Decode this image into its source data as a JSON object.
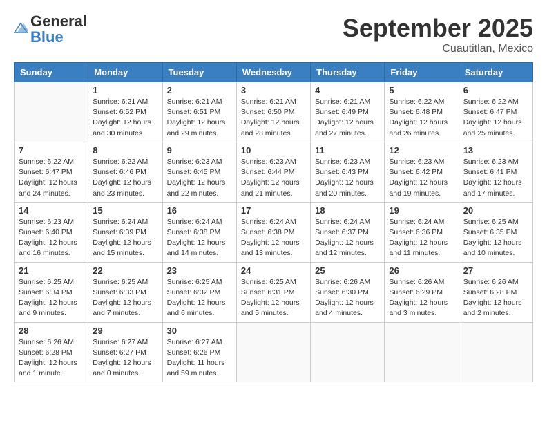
{
  "header": {
    "logo_general": "General",
    "logo_blue": "Blue",
    "title": "September 2025",
    "location": "Cuautitlan, Mexico"
  },
  "weekdays": [
    "Sunday",
    "Monday",
    "Tuesday",
    "Wednesday",
    "Thursday",
    "Friday",
    "Saturday"
  ],
  "weeks": [
    [
      {
        "day": "",
        "info": ""
      },
      {
        "day": "1",
        "info": "Sunrise: 6:21 AM\nSunset: 6:52 PM\nDaylight: 12 hours\nand 30 minutes."
      },
      {
        "day": "2",
        "info": "Sunrise: 6:21 AM\nSunset: 6:51 PM\nDaylight: 12 hours\nand 29 minutes."
      },
      {
        "day": "3",
        "info": "Sunrise: 6:21 AM\nSunset: 6:50 PM\nDaylight: 12 hours\nand 28 minutes."
      },
      {
        "day": "4",
        "info": "Sunrise: 6:21 AM\nSunset: 6:49 PM\nDaylight: 12 hours\nand 27 minutes."
      },
      {
        "day": "5",
        "info": "Sunrise: 6:22 AM\nSunset: 6:48 PM\nDaylight: 12 hours\nand 26 minutes."
      },
      {
        "day": "6",
        "info": "Sunrise: 6:22 AM\nSunset: 6:47 PM\nDaylight: 12 hours\nand 25 minutes."
      }
    ],
    [
      {
        "day": "7",
        "info": "Sunrise: 6:22 AM\nSunset: 6:47 PM\nDaylight: 12 hours\nand 24 minutes."
      },
      {
        "day": "8",
        "info": "Sunrise: 6:22 AM\nSunset: 6:46 PM\nDaylight: 12 hours\nand 23 minutes."
      },
      {
        "day": "9",
        "info": "Sunrise: 6:23 AM\nSunset: 6:45 PM\nDaylight: 12 hours\nand 22 minutes."
      },
      {
        "day": "10",
        "info": "Sunrise: 6:23 AM\nSunset: 6:44 PM\nDaylight: 12 hours\nand 21 minutes."
      },
      {
        "day": "11",
        "info": "Sunrise: 6:23 AM\nSunset: 6:43 PM\nDaylight: 12 hours\nand 20 minutes."
      },
      {
        "day": "12",
        "info": "Sunrise: 6:23 AM\nSunset: 6:42 PM\nDaylight: 12 hours\nand 19 minutes."
      },
      {
        "day": "13",
        "info": "Sunrise: 6:23 AM\nSunset: 6:41 PM\nDaylight: 12 hours\nand 17 minutes."
      }
    ],
    [
      {
        "day": "14",
        "info": "Sunrise: 6:23 AM\nSunset: 6:40 PM\nDaylight: 12 hours\nand 16 minutes."
      },
      {
        "day": "15",
        "info": "Sunrise: 6:24 AM\nSunset: 6:39 PM\nDaylight: 12 hours\nand 15 minutes."
      },
      {
        "day": "16",
        "info": "Sunrise: 6:24 AM\nSunset: 6:38 PM\nDaylight: 12 hours\nand 14 minutes."
      },
      {
        "day": "17",
        "info": "Sunrise: 6:24 AM\nSunset: 6:38 PM\nDaylight: 12 hours\nand 13 minutes."
      },
      {
        "day": "18",
        "info": "Sunrise: 6:24 AM\nSunset: 6:37 PM\nDaylight: 12 hours\nand 12 minutes."
      },
      {
        "day": "19",
        "info": "Sunrise: 6:24 AM\nSunset: 6:36 PM\nDaylight: 12 hours\nand 11 minutes."
      },
      {
        "day": "20",
        "info": "Sunrise: 6:25 AM\nSunset: 6:35 PM\nDaylight: 12 hours\nand 10 minutes."
      }
    ],
    [
      {
        "day": "21",
        "info": "Sunrise: 6:25 AM\nSunset: 6:34 PM\nDaylight: 12 hours\nand 9 minutes."
      },
      {
        "day": "22",
        "info": "Sunrise: 6:25 AM\nSunset: 6:33 PM\nDaylight: 12 hours\nand 7 minutes."
      },
      {
        "day": "23",
        "info": "Sunrise: 6:25 AM\nSunset: 6:32 PM\nDaylight: 12 hours\nand 6 minutes."
      },
      {
        "day": "24",
        "info": "Sunrise: 6:25 AM\nSunset: 6:31 PM\nDaylight: 12 hours\nand 5 minutes."
      },
      {
        "day": "25",
        "info": "Sunrise: 6:26 AM\nSunset: 6:30 PM\nDaylight: 12 hours\nand 4 minutes."
      },
      {
        "day": "26",
        "info": "Sunrise: 6:26 AM\nSunset: 6:29 PM\nDaylight: 12 hours\nand 3 minutes."
      },
      {
        "day": "27",
        "info": "Sunrise: 6:26 AM\nSunset: 6:28 PM\nDaylight: 12 hours\nand 2 minutes."
      }
    ],
    [
      {
        "day": "28",
        "info": "Sunrise: 6:26 AM\nSunset: 6:28 PM\nDaylight: 12 hours\nand 1 minute."
      },
      {
        "day": "29",
        "info": "Sunrise: 6:27 AM\nSunset: 6:27 PM\nDaylight: 12 hours\nand 0 minutes."
      },
      {
        "day": "30",
        "info": "Sunrise: 6:27 AM\nSunset: 6:26 PM\nDaylight: 11 hours\nand 59 minutes."
      },
      {
        "day": "",
        "info": ""
      },
      {
        "day": "",
        "info": ""
      },
      {
        "day": "",
        "info": ""
      },
      {
        "day": "",
        "info": ""
      }
    ]
  ]
}
